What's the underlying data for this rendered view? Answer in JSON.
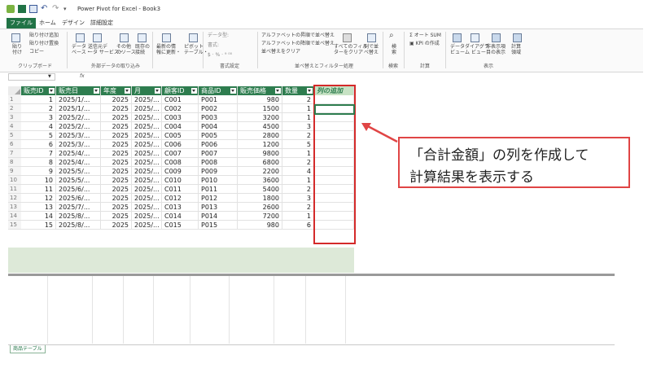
{
  "window": {
    "title": "Power Pivot for Excel - Book3",
    "qa_icons": [
      "excel-icon",
      "app-icon",
      "save-icon",
      "undo-icon",
      "redo-icon",
      "customize-icon"
    ]
  },
  "tabs": [
    {
      "label": "ファイル",
      "active": true
    },
    {
      "label": "ホーム"
    },
    {
      "label": "デザイン"
    },
    {
      "label": "詳細設定"
    }
  ],
  "ribbon": {
    "clipboard": {
      "paste": "貼り\n付け",
      "paste_append": "貼り付け追加",
      "paste_replace": "貼り付け置換",
      "copy": "コピー",
      "group": "クリップボード"
    },
    "external": {
      "db": "データ\nベース・",
      "service": "送信元デ\nータ サービス・",
      "other": "その他\nのソース",
      "existing": "既存の\n接続",
      "group": "外部データの取り込み"
    },
    "refresh": {
      "label": "最新の情\n報に更新・"
    },
    "pivot": {
      "label": "ピボット\nテーブル・"
    },
    "format": {
      "type": "データ型:",
      "fmt": "書式:",
      "sym": "$ · % · ⁹ ⁰⁰",
      "group": "書式設定"
    },
    "sort": {
      "asc": "アルファベットの昇順で並べ替え",
      "desc": "アルファベットの降順で並べ替え",
      "clear": "並べ替えをクリア",
      "clearfilter": "すべてのフィル\nターをクリア",
      "bycol": "列で並\nべ替え",
      "group": "並べ替えとフィルター処理"
    },
    "find": {
      "label": "検\n索",
      "group": "検索"
    },
    "calc": {
      "autosum": "オート SUM",
      "kpi": "KPI の作成",
      "group": "計算"
    },
    "view": {
      "dataview": "データ\nビュー",
      "diagram": "ダイアグラ\nム ビュー",
      "hidden": "非表示項\n目の表示",
      "calcarea": "計算\n領域",
      "group": "表示"
    }
  },
  "formula_bar": {
    "name": "",
    "fx": "fx"
  },
  "table": {
    "columns": [
      "販売ID",
      "販売日",
      "年度",
      "月",
      "顧客ID",
      "商品ID",
      "販売価格",
      "数量"
    ],
    "add_column": "列の追加",
    "rows": [
      [
        "1",
        "2025/1/...",
        "2025",
        "2025/...",
        "C001",
        "P001",
        "980",
        "2"
      ],
      [
        "2",
        "2025/1/...",
        "2025",
        "2025/...",
        "C002",
        "P002",
        "1500",
        "1"
      ],
      [
        "3",
        "2025/2/...",
        "2025",
        "2025/...",
        "C003",
        "P003",
        "3200",
        "1"
      ],
      [
        "4",
        "2025/2/...",
        "2025",
        "2025/...",
        "C004",
        "P004",
        "4500",
        "3"
      ],
      [
        "5",
        "2025/3/...",
        "2025",
        "2025/...",
        "C005",
        "P005",
        "2800",
        "2"
      ],
      [
        "6",
        "2025/3/...",
        "2025",
        "2025/...",
        "C006",
        "P006",
        "1200",
        "5"
      ],
      [
        "7",
        "2025/4/...",
        "2025",
        "2025/...",
        "C007",
        "P007",
        "9800",
        "1"
      ],
      [
        "8",
        "2025/4/...",
        "2025",
        "2025/...",
        "C008",
        "P008",
        "6800",
        "2"
      ],
      [
        "9",
        "2025/5/...",
        "2025",
        "2025/...",
        "C009",
        "P009",
        "2200",
        "4"
      ],
      [
        "10",
        "2025/5/...",
        "2025",
        "2025/...",
        "C010",
        "P010",
        "3600",
        "1"
      ],
      [
        "11",
        "2025/6/...",
        "2025",
        "2025/...",
        "C011",
        "P011",
        "5400",
        "2"
      ],
      [
        "12",
        "2025/6/...",
        "2025",
        "2025/...",
        "C012",
        "P012",
        "1800",
        "3"
      ],
      [
        "13",
        "2025/7/...",
        "2025",
        "2025/...",
        "C013",
        "P013",
        "2600",
        "2"
      ],
      [
        "14",
        "2025/8/...",
        "2025",
        "2025/...",
        "C014",
        "P014",
        "7200",
        "1"
      ],
      [
        "15",
        "2025/8/...",
        "2025",
        "2025/...",
        "C015",
        "P015",
        "980",
        "6"
      ]
    ],
    "row_numbers": [
      "1",
      "2",
      "3",
      "4",
      "5",
      "6",
      "7",
      "8",
      "9",
      "10",
      "11",
      "12",
      "13",
      "14",
      "15"
    ]
  },
  "sheet_tab": "商品テーブル",
  "annotation": {
    "line1": "「合計金額」の列を作成して",
    "line2": "計算結果を表示する",
    "color": "#e04545"
  }
}
